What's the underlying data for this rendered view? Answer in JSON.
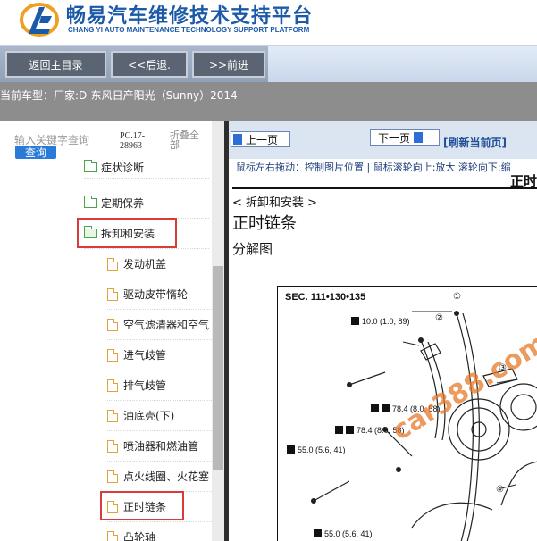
{
  "header": {
    "title_cn": "畅易汽车维修技术支持平台",
    "title_en": "CHANG YI AUTO MAINTENANCE TECHNOLOGY SUPPORT PLATFORM"
  },
  "nav": {
    "home": "返回主目录",
    "back": "<<后退.",
    "forward": ">>前进"
  },
  "car": {
    "label": "当前车型：厂家:D-东风日产阳光（Sunny）2014"
  },
  "sidebar": {
    "search_placeholder": "输入关键字查询",
    "search_button": "查询",
    "version": "PC.17-28963",
    "collapse": "折叠全部",
    "folders": [
      {
        "label": "症状诊断"
      },
      {
        "label": "定期保养"
      },
      {
        "label": "拆卸和安装"
      }
    ],
    "items": [
      {
        "label": "发动机盖"
      },
      {
        "label": "驱动皮带惰轮"
      },
      {
        "label": "空气滤清器和空气"
      },
      {
        "label": "进气歧管"
      },
      {
        "label": "排气歧管"
      },
      {
        "label": "油底壳(下)"
      },
      {
        "label": "喷油器和燃油管"
      },
      {
        "label": "点火线圈、火花塞"
      },
      {
        "label": "正时链条"
      },
      {
        "label": "凸轮轴"
      }
    ]
  },
  "content": {
    "prev_button": "上一页",
    "next_button": "下一页",
    "refresh": "[刷新当前页]",
    "hint": "鼠标左右拖动：控制图片位置 | 鼠标滚轮向上:放大   滚轮向下:缩",
    "corner": "正时",
    "section": "< 拆卸和安装 >",
    "title": "正时链条",
    "subtitle": "分解图"
  },
  "diagram": {
    "sec": "SEC. 111•130•135",
    "torques": [
      "10.0 (1.0, 89)",
      "78.4 (8.0, 58)",
      "78.4 (8.0, 58)",
      "55.0 (5.6, 41)",
      "55.0 (5.6, 41)"
    ],
    "callouts": [
      "①",
      "②",
      "③",
      "④"
    ],
    "watermark": "car388.com"
  },
  "colors": {
    "brand_blue": "#1c5aa8",
    "nav_button": "#5b6472",
    "car_bar": "#8d8d8d",
    "highlight_red": "#d93a3a",
    "folder_green": "#49a349",
    "doc_orange": "#e2a23a"
  }
}
